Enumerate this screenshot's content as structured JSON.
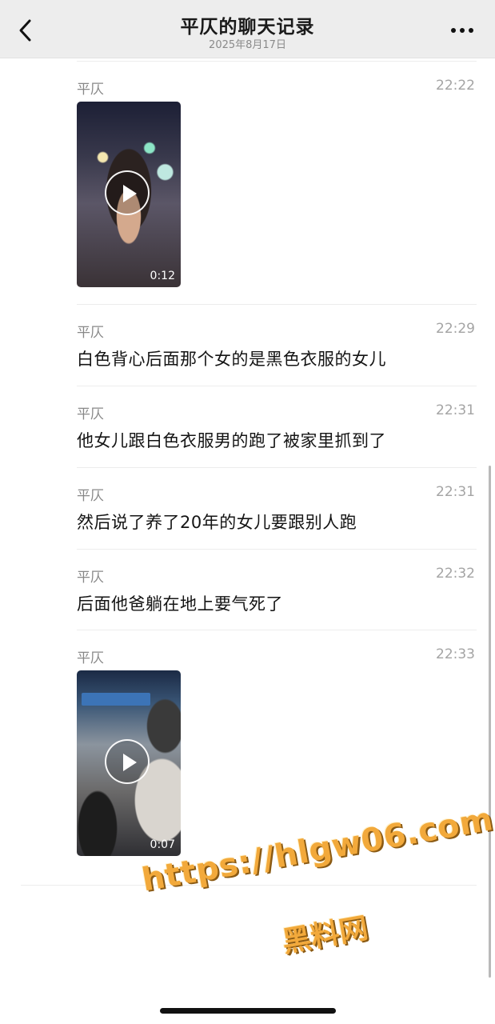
{
  "header": {
    "title": "平仄的聊天记录",
    "date": "2025年8月17日"
  },
  "messages": [
    {
      "sender": "平仄",
      "time": "22:22",
      "type": "video",
      "duration": "0:12"
    },
    {
      "sender": "平仄",
      "time": "22:29",
      "type": "text",
      "text": "白色背心后面那个女的是黑色衣服的女儿"
    },
    {
      "sender": "平仄",
      "time": "22:31",
      "type": "text",
      "text": "他女儿跟白色衣服男的跑了被家里抓到了"
    },
    {
      "sender": "平仄",
      "time": "22:31",
      "type": "text",
      "text": "然后说了养了20年的女儿要跟别人跑"
    },
    {
      "sender": "平仄",
      "time": "22:32",
      "type": "text",
      "text": "后面他爸躺在地上要气死了"
    },
    {
      "sender": "平仄",
      "time": "22:33",
      "type": "video",
      "duration": "0:07"
    }
  ],
  "watermark": {
    "url": "https://hlgw06.com",
    "label": "黑料网",
    "color": "#f2a93b"
  },
  "icons": {
    "back": "chevron-left-icon",
    "more": "more-dots-icon",
    "play": "play-icon"
  }
}
